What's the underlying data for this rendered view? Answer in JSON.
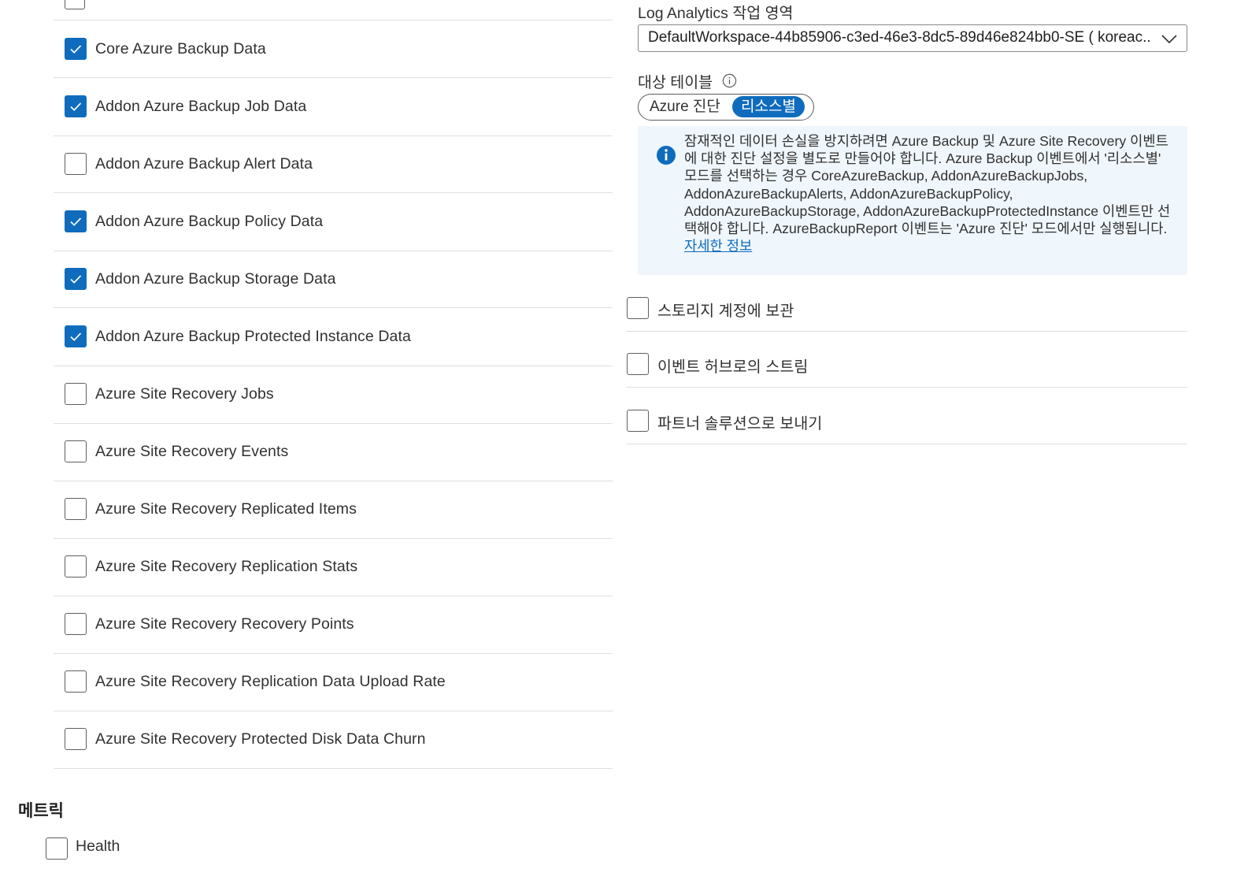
{
  "categories": [
    {
      "label": "Core Azure Backup Data",
      "checked": true
    },
    {
      "label": "Addon Azure Backup Job Data",
      "checked": true
    },
    {
      "label": "Addon Azure Backup Alert Data",
      "checked": false
    },
    {
      "label": "Addon Azure Backup Policy Data",
      "checked": true
    },
    {
      "label": "Addon Azure Backup Storage Data",
      "checked": true
    },
    {
      "label": "Addon Azure Backup Protected Instance Data",
      "checked": true
    },
    {
      "label": "Azure Site Recovery Jobs",
      "checked": false
    },
    {
      "label": "Azure Site Recovery Events",
      "checked": false
    },
    {
      "label": "Azure Site Recovery Replicated Items",
      "checked": false
    },
    {
      "label": "Azure Site Recovery Replication Stats",
      "checked": false
    },
    {
      "label": "Azure Site Recovery Recovery Points",
      "checked": false
    },
    {
      "label": "Azure Site Recovery Replication Data Upload Rate",
      "checked": false
    },
    {
      "label": "Azure Site Recovery Protected Disk Data Churn",
      "checked": false
    }
  ],
  "metrics": {
    "heading": "메트릭",
    "items": [
      {
        "label": "Health",
        "checked": false
      }
    ]
  },
  "destination": {
    "log_analytics_label": "Log Analytics 작업 영역",
    "workspace_value": "DefaultWorkspace-44b85906-c3ed-46e3-8dc5-89d46e824bb0-SE ( koreac...",
    "target_table_label": "대상 테이블",
    "toggle_options": [
      "Azure 진단",
      "리소스별"
    ],
    "toggle_selected": "리소스별",
    "info_text": "잠재적인 데이터 손실을 방지하려면 Azure Backup 및 Azure Site Recovery 이벤트에 대한 진단 설정을 별도로 만들어야 합니다. Azure Backup 이벤트에서 '리소스별' 모드를 선택하는 경우 CoreAzureBackup, AddonAzureBackupJobs, AddonAzureBackupAlerts, AddonAzureBackupPolicy, AddonAzureBackupStorage, AddonAzureBackupProtectedInstance 이벤트만 선택해야 합니다. AzureBackupReport 이벤트는 'Azure 진단' 모드에서만 실행됩니다. ",
    "info_link": "자세한 정보",
    "options": [
      {
        "label": "스토리지 계정에 보관",
        "checked": false
      },
      {
        "label": "이벤트 허브로의 스트림",
        "checked": false
      },
      {
        "label": "파트너 솔루션으로 보내기",
        "checked": false
      }
    ]
  },
  "colors": {
    "accent": "#0f6cbd",
    "info_bg": "#eff6fc",
    "border": "#605e5c",
    "divider": "#e1dfdd"
  }
}
